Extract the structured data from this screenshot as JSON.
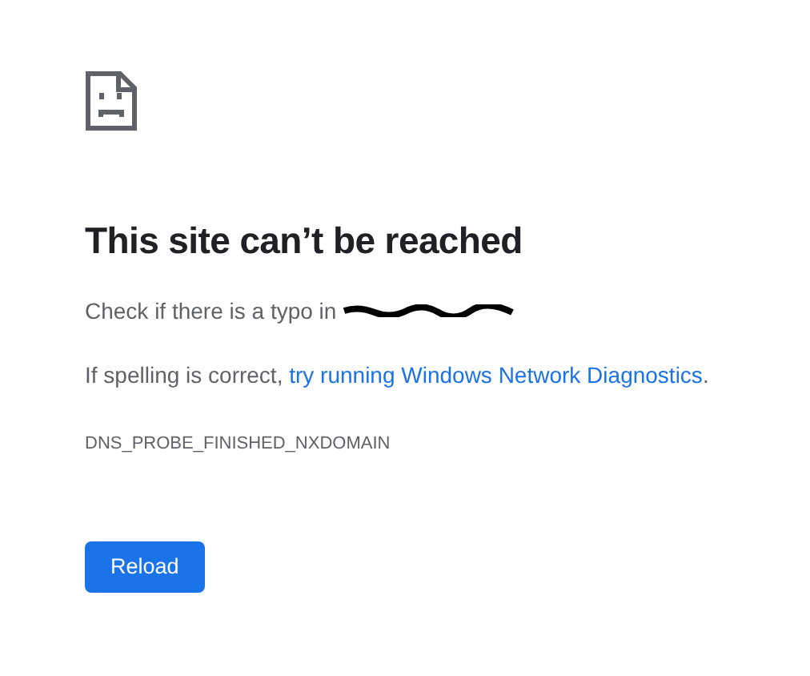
{
  "title": "This site can’t be reached",
  "check_text": "Check if there is a typo in",
  "domain": {
    "redacted": true
  },
  "suggestion": {
    "text": "If spelling is correct,",
    "link": "try running Windows Network Diagnostics",
    "end": "."
  },
  "error_code": "DNS_PROBE_FINISHED_NXDOMAIN",
  "buttons": [
    "Reload"
  ]
}
